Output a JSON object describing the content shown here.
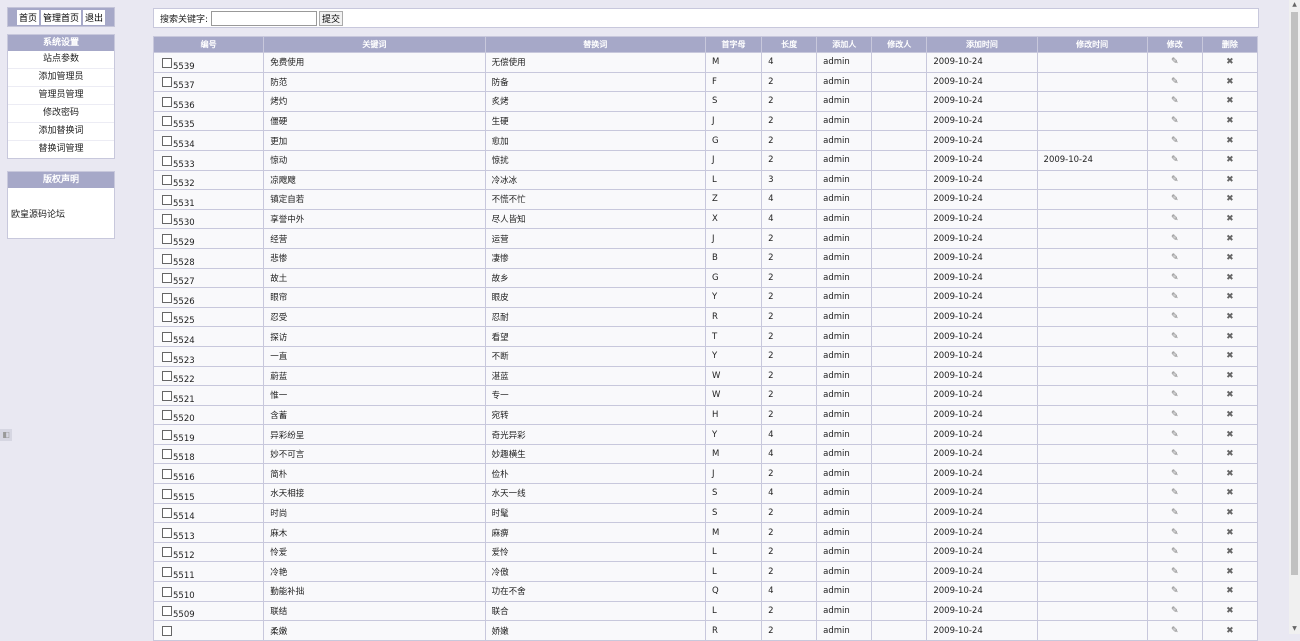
{
  "nav": {
    "home": "首页",
    "admin_home": "管理首页",
    "logout": "退出"
  },
  "sidebar": {
    "section_title": "系统设置",
    "items": [
      {
        "label": "站点参数"
      },
      {
        "label": "添加管理员"
      },
      {
        "label": "管理员管理"
      },
      {
        "label": "修改密码"
      },
      {
        "label": "添加替换词"
      },
      {
        "label": "替换词管理"
      }
    ],
    "copyright_title": "版权声明",
    "copyright_text": "欧皇源码论坛",
    "collapse_glyph": "◧"
  },
  "search": {
    "label": "搜索关键字:",
    "value": "",
    "placeholder": "",
    "submit": "提交"
  },
  "table": {
    "headers": [
      "编号",
      "关键词",
      "替换词",
      "首字母",
      "长度",
      "添加人",
      "修改人",
      "添加时间",
      "修改时间",
      "修改",
      "删除"
    ],
    "rows": [
      {
        "id": "5539",
        "keyword": "免费使用",
        "replace": "无偿使用",
        "letter": "M",
        "length": "4",
        "adder": "admin",
        "modifier": "",
        "add_time": "2009-10-24",
        "mod_time": ""
      },
      {
        "id": "5537",
        "keyword": "防范",
        "replace": "防备",
        "letter": "F",
        "length": "2",
        "adder": "admin",
        "modifier": "",
        "add_time": "2009-10-24",
        "mod_time": ""
      },
      {
        "id": "5536",
        "keyword": "烤灼",
        "replace": "炙烤",
        "letter": "S",
        "length": "2",
        "adder": "admin",
        "modifier": "",
        "add_time": "2009-10-24",
        "mod_time": ""
      },
      {
        "id": "5535",
        "keyword": "僵硬",
        "replace": "生硬",
        "letter": "J",
        "length": "2",
        "adder": "admin",
        "modifier": "",
        "add_time": "2009-10-24",
        "mod_time": ""
      },
      {
        "id": "5534",
        "keyword": "更加",
        "replace": "愈加",
        "letter": "G",
        "length": "2",
        "adder": "admin",
        "modifier": "",
        "add_time": "2009-10-24",
        "mod_time": ""
      },
      {
        "id": "5533",
        "keyword": "惊动",
        "replace": "惊扰",
        "letter": "J",
        "length": "2",
        "adder": "admin",
        "modifier": "",
        "add_time": "2009-10-24",
        "mod_time": "2009-10-24"
      },
      {
        "id": "5532",
        "keyword": "凉飕飕",
        "replace": "冷冰冰",
        "letter": "L",
        "length": "3",
        "adder": "admin",
        "modifier": "",
        "add_time": "2009-10-24",
        "mod_time": ""
      },
      {
        "id": "5531",
        "keyword": "镇定自若",
        "replace": "不慌不忙",
        "letter": "Z",
        "length": "4",
        "adder": "admin",
        "modifier": "",
        "add_time": "2009-10-24",
        "mod_time": ""
      },
      {
        "id": "5530",
        "keyword": "享誉中外",
        "replace": "尽人皆知",
        "letter": "X",
        "length": "4",
        "adder": "admin",
        "modifier": "",
        "add_time": "2009-10-24",
        "mod_time": ""
      },
      {
        "id": "5529",
        "keyword": "经营",
        "replace": "运营",
        "letter": "J",
        "length": "2",
        "adder": "admin",
        "modifier": "",
        "add_time": "2009-10-24",
        "mod_time": ""
      },
      {
        "id": "5528",
        "keyword": "悲惨",
        "replace": "凄惨",
        "letter": "B",
        "length": "2",
        "adder": "admin",
        "modifier": "",
        "add_time": "2009-10-24",
        "mod_time": ""
      },
      {
        "id": "5527",
        "keyword": "故土",
        "replace": "故乡",
        "letter": "G",
        "length": "2",
        "adder": "admin",
        "modifier": "",
        "add_time": "2009-10-24",
        "mod_time": ""
      },
      {
        "id": "5526",
        "keyword": "眼帘",
        "replace": "眼皮",
        "letter": "Y",
        "length": "2",
        "adder": "admin",
        "modifier": "",
        "add_time": "2009-10-24",
        "mod_time": ""
      },
      {
        "id": "5525",
        "keyword": "忍受",
        "replace": "忍耐",
        "letter": "R",
        "length": "2",
        "adder": "admin",
        "modifier": "",
        "add_time": "2009-10-24",
        "mod_time": ""
      },
      {
        "id": "5524",
        "keyword": "探访",
        "replace": "看望",
        "letter": "T",
        "length": "2",
        "adder": "admin",
        "modifier": "",
        "add_time": "2009-10-24",
        "mod_time": ""
      },
      {
        "id": "5523",
        "keyword": "一直",
        "replace": "不断",
        "letter": "Y",
        "length": "2",
        "adder": "admin",
        "modifier": "",
        "add_time": "2009-10-24",
        "mod_time": ""
      },
      {
        "id": "5522",
        "keyword": "蔚蓝",
        "replace": "湛蓝",
        "letter": "W",
        "length": "2",
        "adder": "admin",
        "modifier": "",
        "add_time": "2009-10-24",
        "mod_time": ""
      },
      {
        "id": "5521",
        "keyword": "惟一",
        "replace": "专一",
        "letter": "W",
        "length": "2",
        "adder": "admin",
        "modifier": "",
        "add_time": "2009-10-24",
        "mod_time": ""
      },
      {
        "id": "5520",
        "keyword": "含蓄",
        "replace": "宛转",
        "letter": "H",
        "length": "2",
        "adder": "admin",
        "modifier": "",
        "add_time": "2009-10-24",
        "mod_time": ""
      },
      {
        "id": "5519",
        "keyword": "异彩纷呈",
        "replace": "奇光异彩",
        "letter": "Y",
        "length": "4",
        "adder": "admin",
        "modifier": "",
        "add_time": "2009-10-24",
        "mod_time": ""
      },
      {
        "id": "5518",
        "keyword": "妙不可言",
        "replace": "妙趣横生",
        "letter": "M",
        "length": "4",
        "adder": "admin",
        "modifier": "",
        "add_time": "2009-10-24",
        "mod_time": ""
      },
      {
        "id": "5516",
        "keyword": "简朴",
        "replace": "俭朴",
        "letter": "J",
        "length": "2",
        "adder": "admin",
        "modifier": "",
        "add_time": "2009-10-24",
        "mod_time": ""
      },
      {
        "id": "5515",
        "keyword": "水天相接",
        "replace": "水天一线",
        "letter": "S",
        "length": "4",
        "adder": "admin",
        "modifier": "",
        "add_time": "2009-10-24",
        "mod_time": ""
      },
      {
        "id": "5514",
        "keyword": "时尚",
        "replace": "时髦",
        "letter": "S",
        "length": "2",
        "adder": "admin",
        "modifier": "",
        "add_time": "2009-10-24",
        "mod_time": ""
      },
      {
        "id": "5513",
        "keyword": "麻木",
        "replace": "麻痹",
        "letter": "M",
        "length": "2",
        "adder": "admin",
        "modifier": "",
        "add_time": "2009-10-24",
        "mod_time": ""
      },
      {
        "id": "5512",
        "keyword": "怜爱",
        "replace": "爱怜",
        "letter": "L",
        "length": "2",
        "adder": "admin",
        "modifier": "",
        "add_time": "2009-10-24",
        "mod_time": ""
      },
      {
        "id": "5511",
        "keyword": "冷艳",
        "replace": "冷傲",
        "letter": "L",
        "length": "2",
        "adder": "admin",
        "modifier": "",
        "add_time": "2009-10-24",
        "mod_time": ""
      },
      {
        "id": "5510",
        "keyword": "勤能补拙",
        "replace": "功在不舍",
        "letter": "Q",
        "length": "4",
        "adder": "admin",
        "modifier": "",
        "add_time": "2009-10-24",
        "mod_time": ""
      },
      {
        "id": "5509",
        "keyword": "联结",
        "replace": "联合",
        "letter": "L",
        "length": "2",
        "adder": "admin",
        "modifier": "",
        "add_time": "2009-10-24",
        "mod_time": ""
      },
      {
        "id": "",
        "keyword": "柔嫩",
        "replace": "娇嫩",
        "letter": "R",
        "length": "2",
        "adder": "admin",
        "modifier": "",
        "add_time": "2009-10-24",
        "mod_time": ""
      }
    ],
    "edit_glyph": "✎",
    "delete_glyph": "✖"
  },
  "colors": {
    "header_bg": "#a6a8c8",
    "page_bg": "#e9e8f2",
    "row_bg": "#f9f9fb"
  }
}
